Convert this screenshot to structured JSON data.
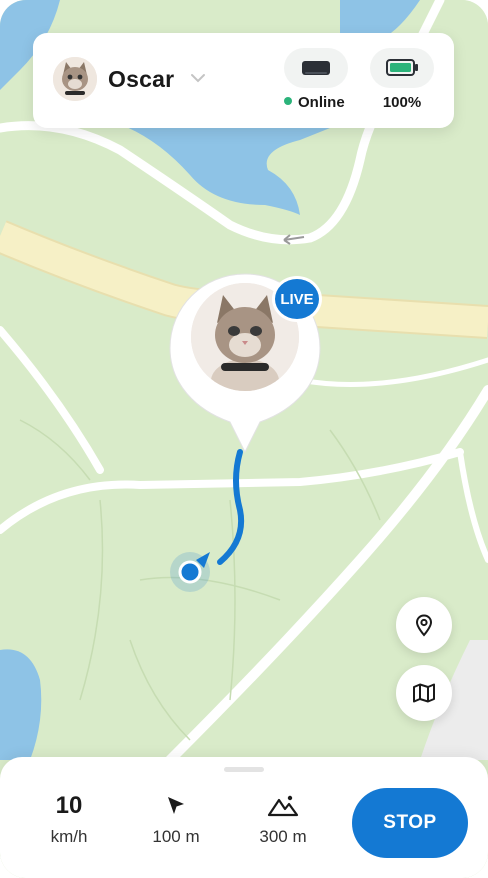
{
  "pet": {
    "name": "Oscar"
  },
  "device": {
    "status": "Online",
    "battery": "100%"
  },
  "pin": {
    "badge": "LIVE"
  },
  "stats": {
    "speed_value": "10",
    "speed_unit": "km/h",
    "distance": "100 m",
    "altitude": "300 m"
  },
  "actions": {
    "stop_label": "STOP"
  },
  "icons": {
    "chevron": "chevron-down-icon",
    "tracker": "tracker-device-icon",
    "battery": "battery-full-icon",
    "locate": "location-pin-icon",
    "layers": "map-icon",
    "distance": "navigation-arrow-icon",
    "altitude": "mountain-icon"
  },
  "colors": {
    "accent": "#1479d3",
    "online": "#2bb37a",
    "battery": "#2bb37a",
    "water": "#8ec3e6",
    "land": "#d9ebc9",
    "major_road": "#f6f0c6"
  },
  "battery_level": 1.0
}
